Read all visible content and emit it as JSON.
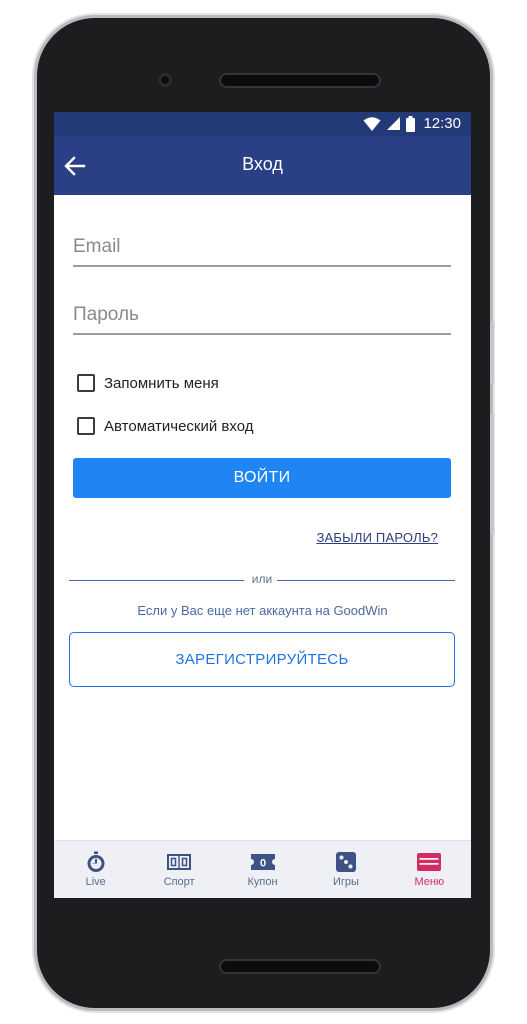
{
  "status": {
    "time": "12:30"
  },
  "appbar": {
    "title": "Вход"
  },
  "form": {
    "email_placeholder": "Email",
    "email_value": "",
    "password_placeholder": "Пароль",
    "password_value": "",
    "remember_label": "Запомнить меня",
    "remember_checked": false,
    "auto_login_label": "Автоматический вход",
    "auto_login_checked": false,
    "login_label": "ВОЙТИ",
    "forgot_label": "ЗАБЫЛИ ПАРОЛЬ?"
  },
  "divider": {
    "text": "или"
  },
  "register": {
    "prompt": "Если у Вас еще нет аккаунта на GoodWin",
    "button_label": "ЗАРЕГИСТРИРУЙТЕСЬ"
  },
  "bottom_nav": {
    "items": [
      {
        "label": "Live",
        "icon": "stopwatch-icon",
        "active": false
      },
      {
        "label": "Спорт",
        "icon": "scoreboard-icon",
        "active": false
      },
      {
        "label": "Купон",
        "icon": "ticket-icon",
        "active": false
      },
      {
        "label": "Игры",
        "icon": "dice-icon",
        "active": false
      },
      {
        "label": "Меню",
        "icon": "menu-icon",
        "active": true
      }
    ]
  },
  "colors": {
    "appbar": "#2b3f87",
    "statusbar": "#243978",
    "primary_button": "#1f85f5",
    "register_border": "#1f74e0",
    "active_nav": "#d42b63",
    "nav_icon": "#3e5384"
  }
}
